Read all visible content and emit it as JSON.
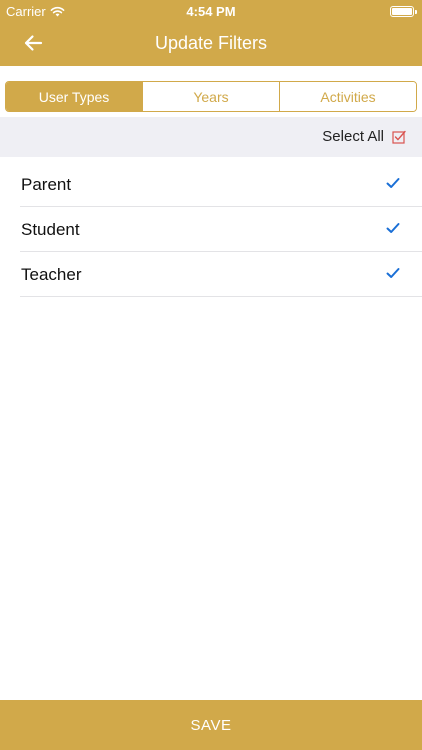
{
  "status_bar": {
    "carrier": "Carrier",
    "time": "4:54 PM",
    "icons": [
      "wifi-icon",
      "battery-icon"
    ]
  },
  "header": {
    "title": "Update Filters",
    "back_icon": "arrow-left-icon"
  },
  "tabs": [
    {
      "label": "User Types",
      "selected": true
    },
    {
      "label": "Years",
      "selected": false
    },
    {
      "label": "Activities",
      "selected": false
    }
  ],
  "select_all": {
    "label": "Select All",
    "checked": true,
    "icon": "checkbox-checked-icon"
  },
  "list": {
    "items": [
      {
        "label": "Parent",
        "checked": true
      },
      {
        "label": "Student",
        "checked": true
      },
      {
        "label": "Teacher",
        "checked": true
      }
    ]
  },
  "footer": {
    "save_label": "SAVE"
  },
  "colors": {
    "accent": "#d1a94a",
    "check": "#1a6fd6",
    "select_all_check": "#d9534f",
    "section_bg": "#efeff4"
  }
}
